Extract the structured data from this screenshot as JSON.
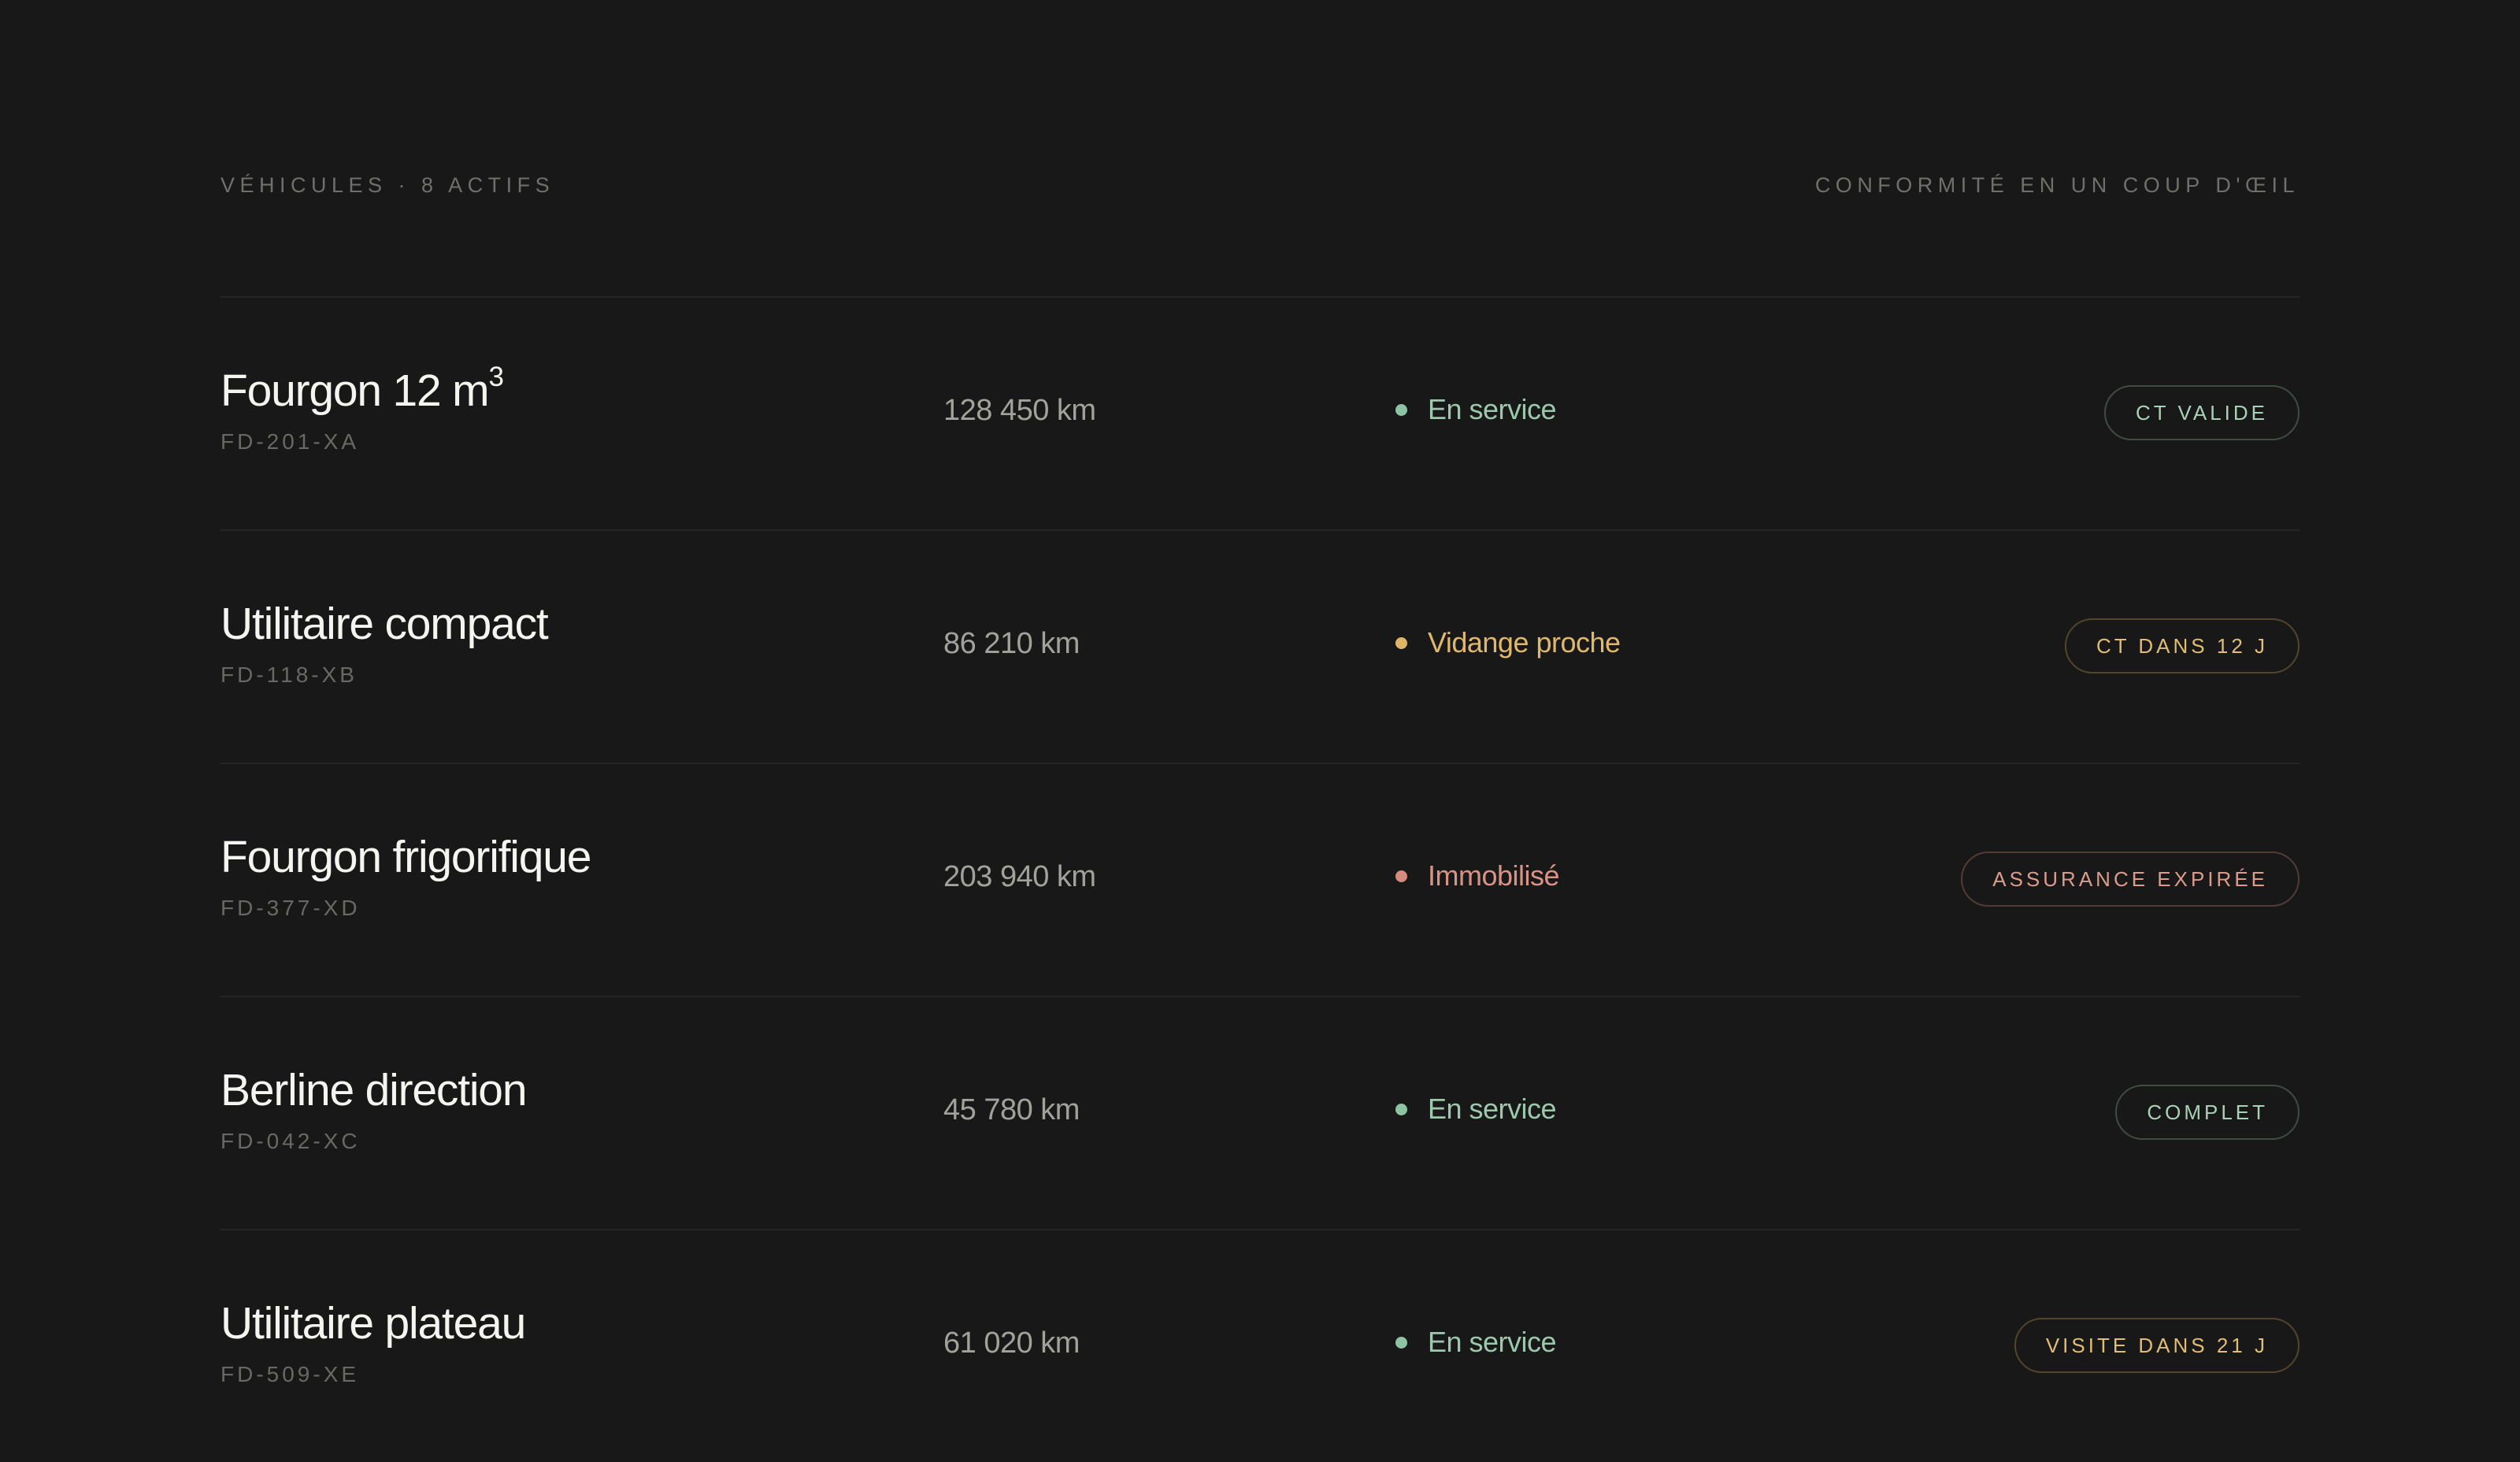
{
  "header": {
    "left_label": "Véhicules · 8 actifs",
    "right_label": "Conformité en un coup d'œil"
  },
  "colors": {
    "background": "#181818",
    "ok": "#8cc3a2",
    "warn": "#ddb567",
    "bad": "#d68a7c"
  },
  "vehicles": [
    {
      "name": "Fourgon 12 m",
      "name_sup": "3",
      "plate": "FD-201-XA",
      "km": "128 450 km",
      "status": "En service",
      "status_tone": "ok",
      "badge": "CT valide",
      "badge_tone": "ok"
    },
    {
      "name": "Utilitaire compact",
      "name_sup": "",
      "plate": "FD-118-XB",
      "km": "86 210 km",
      "status": "Vidange proche",
      "status_tone": "warn",
      "badge": "CT dans 12 j",
      "badge_tone": "warn"
    },
    {
      "name": "Fourgon frigorifique",
      "name_sup": "",
      "plate": "FD-377-XD",
      "km": "203 940 km",
      "status": "Immobilisé",
      "status_tone": "bad",
      "badge": "Assurance expirée",
      "badge_tone": "bad"
    },
    {
      "name": "Berline direction",
      "name_sup": "",
      "plate": "FD-042-XC",
      "km": "45 780 km",
      "status": "En service",
      "status_tone": "ok",
      "badge": "Complet",
      "badge_tone": "ok"
    },
    {
      "name": "Utilitaire plateau",
      "name_sup": "",
      "plate": "FD-509-XE",
      "km": "61 020 km",
      "status": "En service",
      "status_tone": "ok",
      "badge": "Visite dans 21 j",
      "badge_tone": "warn"
    }
  ]
}
